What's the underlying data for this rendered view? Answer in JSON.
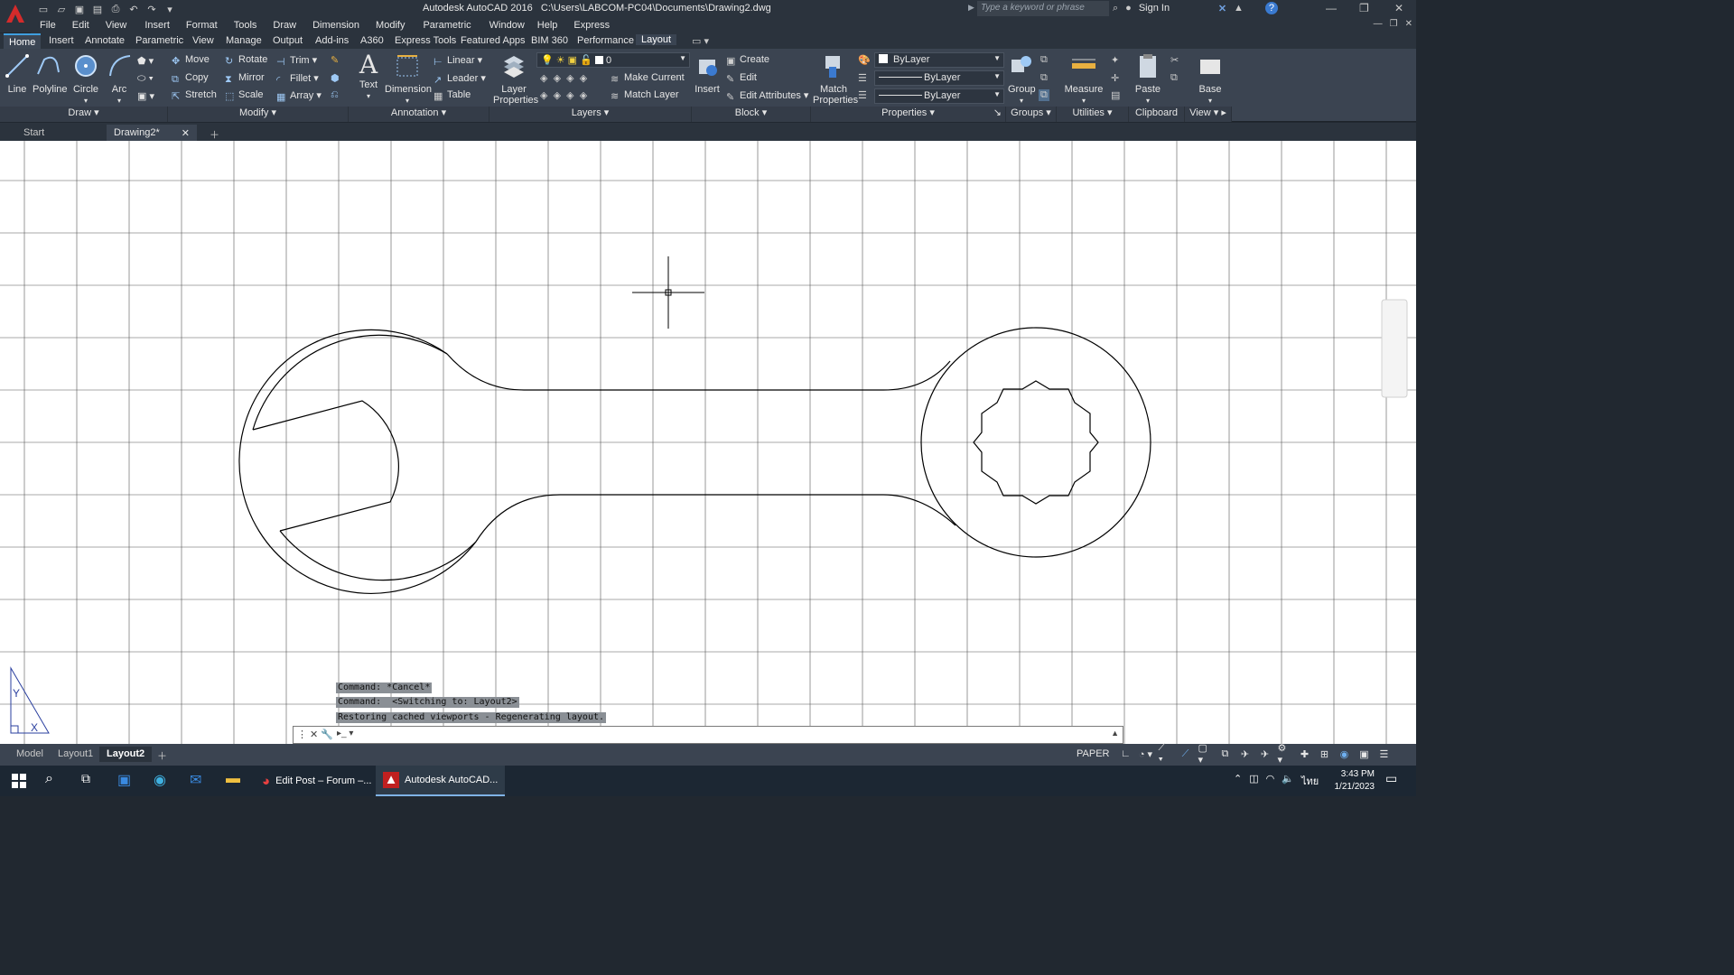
{
  "titlebar": {
    "app": "Autodesk AutoCAD 2016",
    "path": "C:\\Users\\LABCOM-PC04\\Documents\\Drawing2.dwg",
    "search_placeholder": "Type a keyword or phrase",
    "sign_in": "Sign In"
  },
  "menubar": [
    "File",
    "Edit",
    "View",
    "Insert",
    "Format",
    "Tools",
    "Draw",
    "Dimension",
    "Modify",
    "Parametric",
    "Window",
    "Help",
    "Express"
  ],
  "ribbon_tabs": [
    "Home",
    "Insert",
    "Annotate",
    "Parametric",
    "View",
    "Manage",
    "Output",
    "Add-ins",
    "A360",
    "Express Tools",
    "Featured Apps",
    "BIM 360",
    "Performance",
    "Layout"
  ],
  "ribbon": {
    "draw": {
      "line": "Line",
      "polyline": "Polyline",
      "circle": "Circle",
      "arc": "Arc",
      "panel": "Draw"
    },
    "modify": {
      "move": "Move",
      "rotate": "Rotate",
      "trim": "Trim",
      "copy": "Copy",
      "mirror": "Mirror",
      "fillet": "Fillet",
      "stretch": "Stretch",
      "scale": "Scale",
      "array": "Array",
      "panel": "Modify"
    },
    "annotation": {
      "text": "Text",
      "dimension": "Dimension",
      "linear": "Linear",
      "leader": "Leader",
      "table": "Table",
      "panel": "Annotation"
    },
    "layers": {
      "layer_properties_1": "Layer",
      "layer_properties_2": "Properties",
      "layer_value": "0",
      "make_current": "Make Current",
      "match_layer": "Match Layer",
      "panel": "Layers"
    },
    "block": {
      "insert": "Insert",
      "create": "Create",
      "edit": "Edit",
      "edit_attributes": "Edit Attributes",
      "panel": "Block"
    },
    "properties": {
      "match_1": "Match",
      "match_2": "Properties",
      "color": "ByLayer",
      "linetype": "ByLayer",
      "lineweight": "ByLayer",
      "panel": "Properties"
    },
    "groups": {
      "group": "Group",
      "panel": "Groups"
    },
    "utilities": {
      "measure": "Measure",
      "panel": "Utilities"
    },
    "clipboard": {
      "paste": "Paste",
      "panel": "Clipboard"
    },
    "view": {
      "base": "Base",
      "panel": "View"
    }
  },
  "file_tabs": {
    "start": "Start",
    "drawing": "Drawing2*"
  },
  "command_history": [
    "Command: *Cancel*",
    "Command:  <Switching to: Layout2>",
    "Restoring cached viewports - Regenerating layout."
  ],
  "layout_tabs": [
    "Model",
    "Layout1",
    "Layout2"
  ],
  "status": {
    "paper": "PAPER"
  },
  "taskbar": {
    "app1": "Edit Post – Forum –...",
    "app2": "Autodesk AutoCAD...",
    "time": "3:43 PM",
    "date": "1/21/2023"
  }
}
